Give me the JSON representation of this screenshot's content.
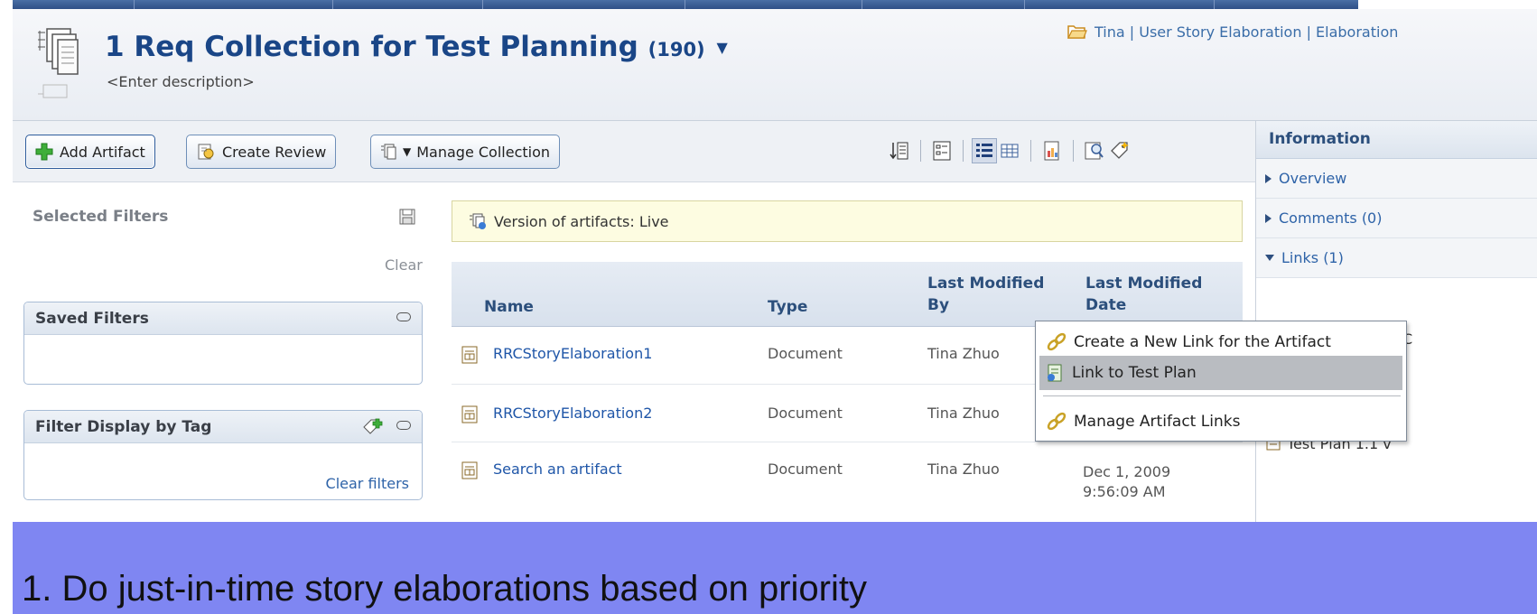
{
  "header": {
    "title": "1 Req Collection for Test Planning",
    "count": "(190)",
    "description": "<Enter description>",
    "project_path": "Tina | User Story Elaboration | Elaboration"
  },
  "toolbar": {
    "add_artifact": "Add Artifact",
    "create_review": "Create Review",
    "manage_collection": "Manage Collection"
  },
  "filters": {
    "selected_title": "Selected Filters",
    "clear": "Clear",
    "saved_title": "Saved Filters",
    "tag_title": "Filter Display by Tag",
    "clear_filters": "Clear filters"
  },
  "version_bar": "Version of artifacts: Live",
  "table": {
    "headers": {
      "name": "Name",
      "type": "Type",
      "modified_by_1": "Last Modified",
      "modified_by_2": "By",
      "modified_date_1": "Last Modified",
      "modified_date_2": "Date"
    },
    "rows": [
      {
        "name": "RRCStoryElaboration1",
        "type": "Document",
        "by": "Tina Zhuo",
        "date_1": "",
        "date_2": ""
      },
      {
        "name": "RRCStoryElaboration2",
        "type": "Document",
        "by": "Tina Zhuo",
        "date_1": "",
        "date_2": ""
      },
      {
        "name": "Search an artifact",
        "type": "Document",
        "by": "Tina Zhuo",
        "date_1": "Dec 1, 2009",
        "date_2": "9:56:09 AM"
      }
    ]
  },
  "info_panel": {
    "title": "Information",
    "items": [
      "Overview",
      "Comments (0)",
      "Links (1)"
    ],
    "link_item": "Test Plan 1.1 v",
    "side_letter": "C"
  },
  "context_menu": {
    "items": [
      "Create a New Link for the Artifact",
      "Link to Test Plan",
      "Manage Artifact Links"
    ]
  },
  "banner": "1.  Do just-in-time story elaborations based on priority",
  "colors": {
    "title_blue": "#1a4687",
    "link_blue": "#1f56a8",
    "banner": "#7f86f2",
    "version_bar": "#fdfce1",
    "menu_highlight": "#b9bcc1"
  }
}
